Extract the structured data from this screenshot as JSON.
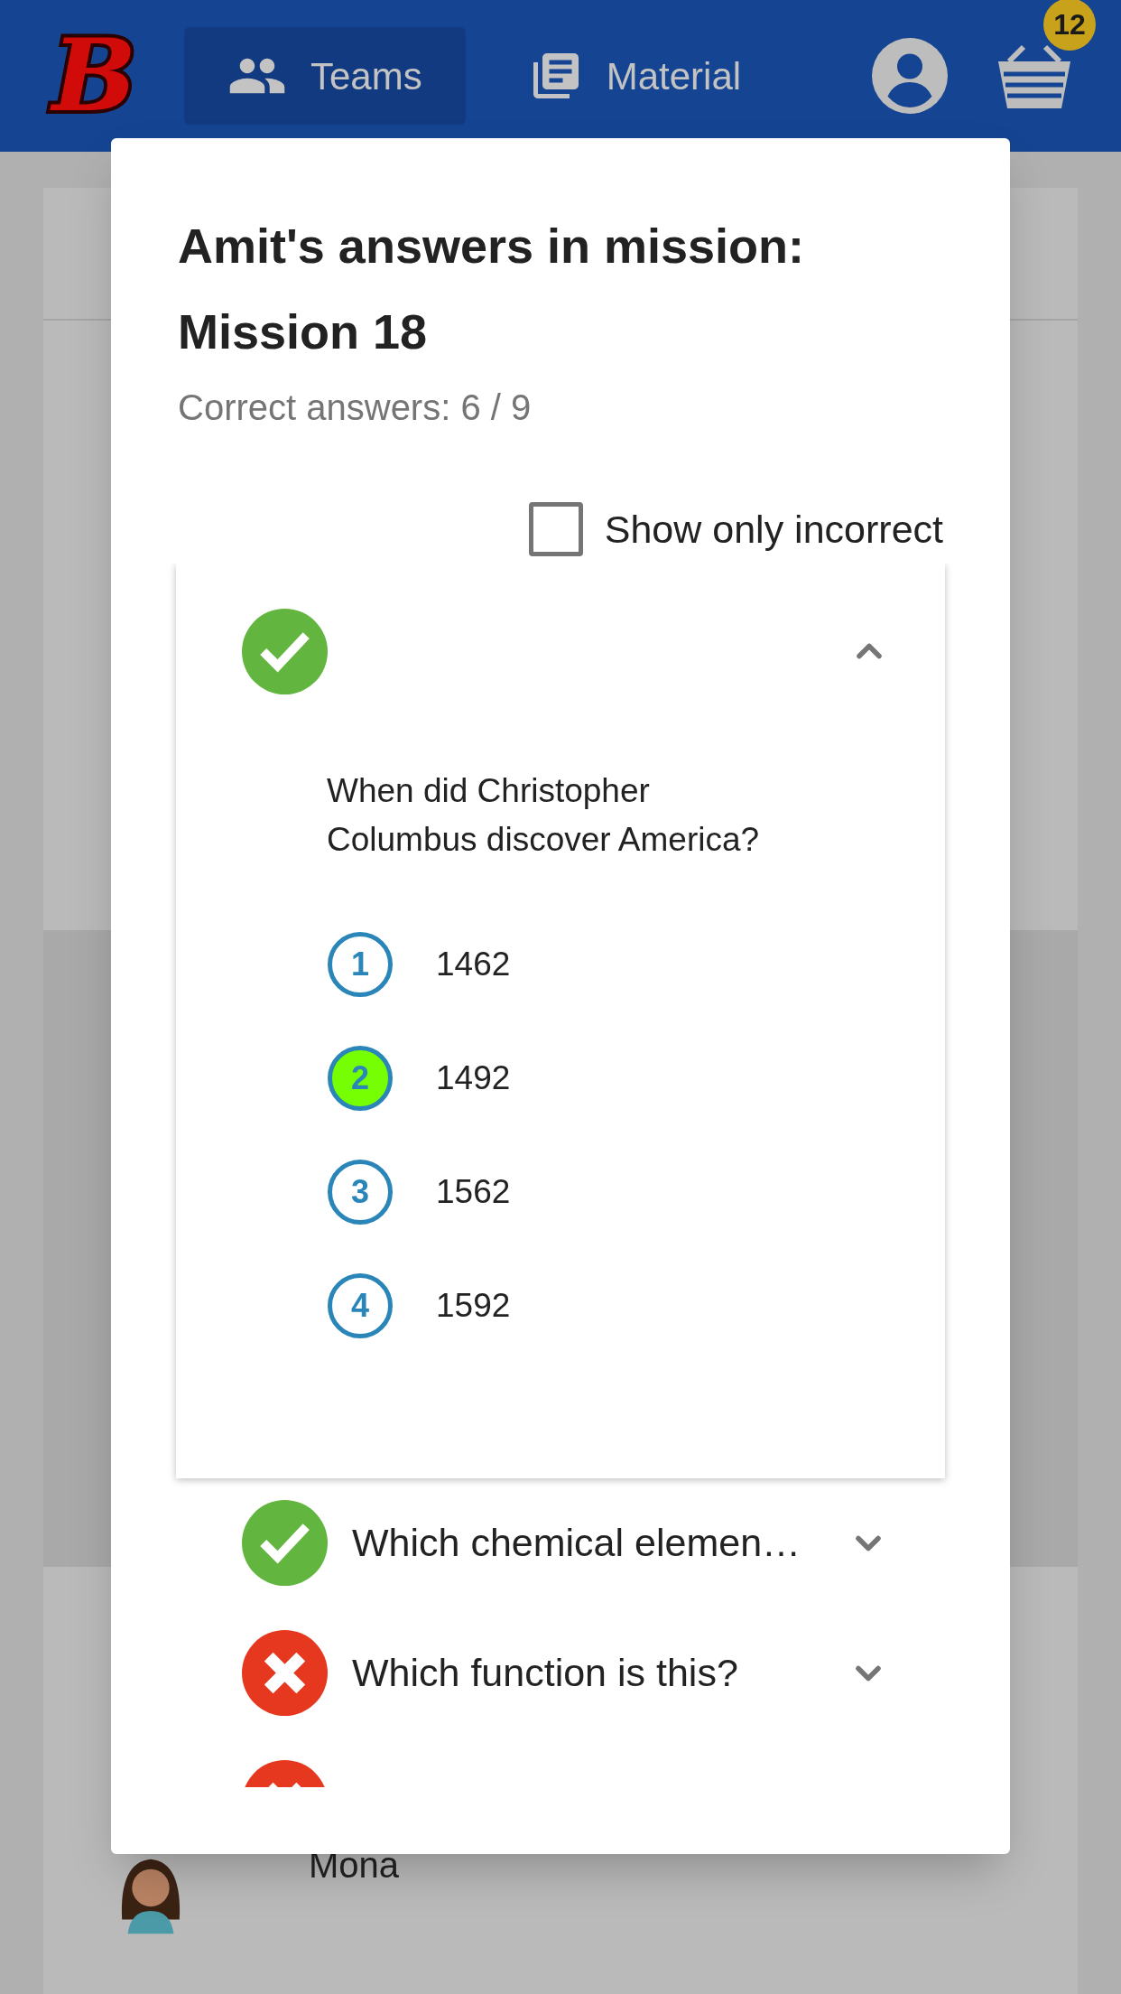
{
  "header": {
    "logo": "B",
    "tabs": [
      {
        "label": "Teams",
        "selected": true
      },
      {
        "label": "Material",
        "selected": false
      }
    ],
    "cart_badge": "12"
  },
  "background": {
    "members": [
      {
        "name": "Mona"
      }
    ]
  },
  "dialog": {
    "title": "Amit's answers in mission: Mission 18",
    "summary": "Correct answers: 6 / 9",
    "filter": {
      "label": "Show only incorrect",
      "checked": false
    },
    "questions": [
      {
        "correct": true,
        "expanded": true,
        "question": "When did Christopher Columbus discover America?",
        "options": [
          {
            "number": "1",
            "text": "1462",
            "selected": false
          },
          {
            "number": "2",
            "text": "1492",
            "selected": true
          },
          {
            "number": "3",
            "text": "1562",
            "selected": false
          },
          {
            "number": "4",
            "text": "1592",
            "selected": false
          }
        ]
      },
      {
        "correct": true,
        "expanded": false,
        "title": "Which chemical elemen…"
      },
      {
        "correct": false,
        "expanded": false,
        "title": "Which function is this?"
      },
      {
        "correct": false
      }
    ]
  }
}
